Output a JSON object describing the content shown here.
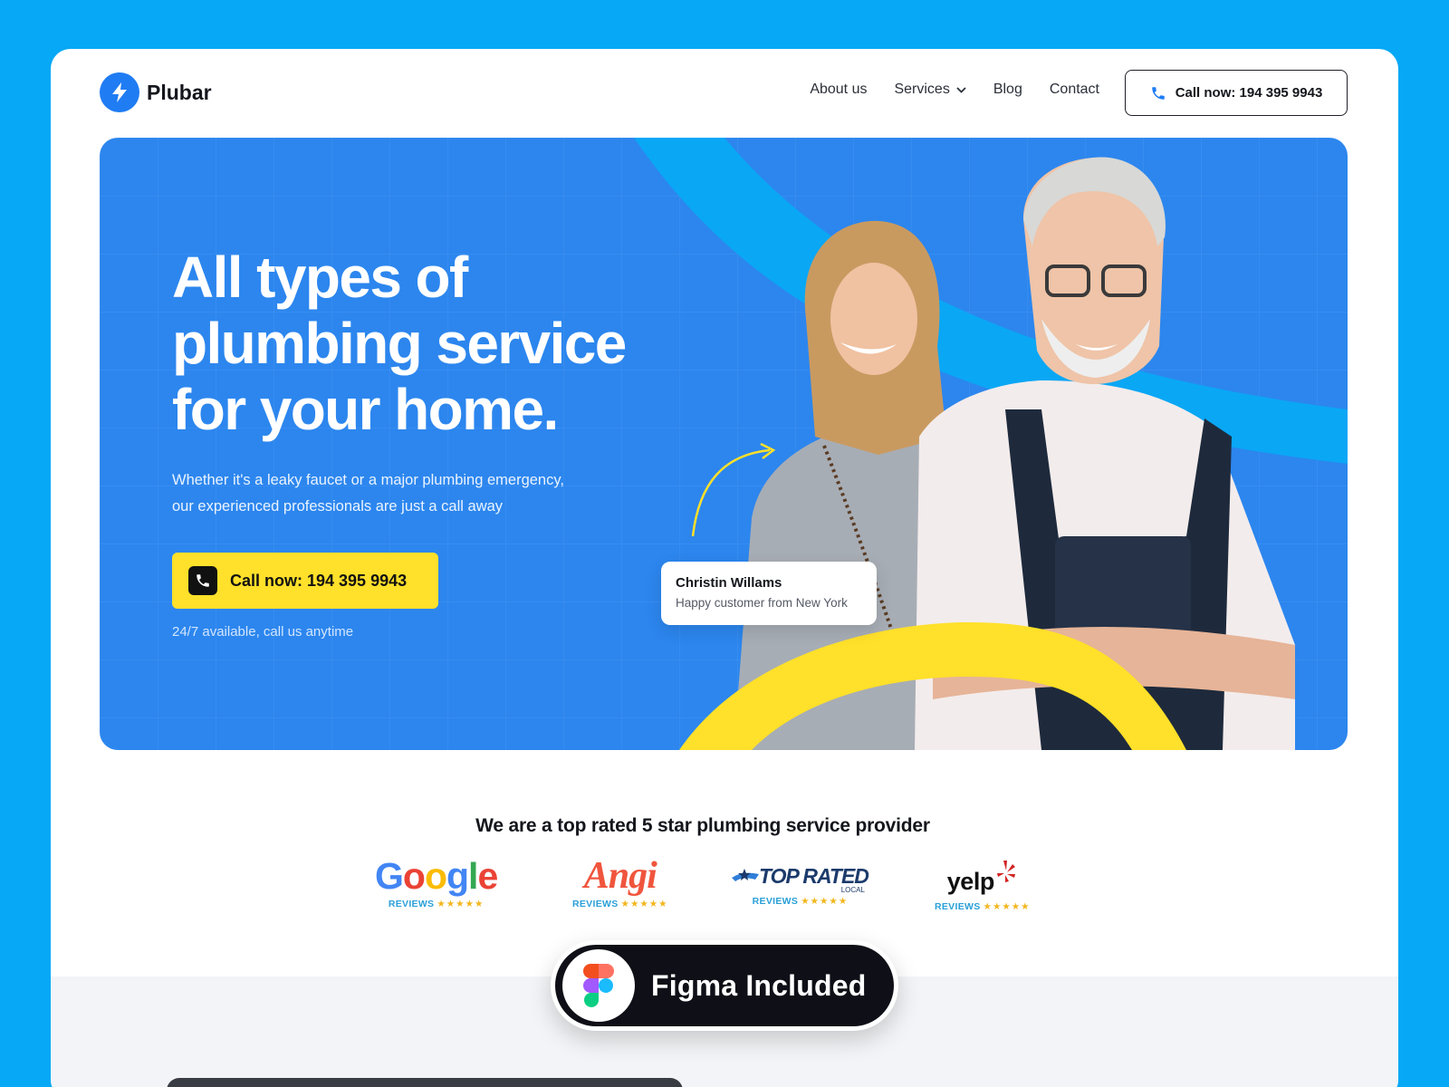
{
  "brand": {
    "name": "Plubar",
    "accent": "#1f7cf3",
    "icon": "lightning-icon"
  },
  "nav": {
    "items": [
      {
        "label": "About us",
        "dropdown": false
      },
      {
        "label": "Services",
        "dropdown": true
      },
      {
        "label": "Blog",
        "dropdown": false
      },
      {
        "label": "Contact",
        "dropdown": false
      }
    ],
    "cta_label": "Call now: 194 395 9943"
  },
  "hero": {
    "title_lines": [
      "All types of",
      "plumbing service",
      "for your home."
    ],
    "subtitle_lines": [
      "Whether it's a leaky faucet or a major plumbing emergency,",
      "our experienced professionals are just a call away"
    ],
    "cta_label": "Call now: 194 395 9943",
    "note": "24/7 available, call us anytime",
    "background": "#2c86ee",
    "cta_color": "#ffe02a",
    "testimonial": {
      "name": "Christin Willams",
      "role": "Happy customer from New York"
    }
  },
  "ratings": {
    "title": "We are a top rated 5 star plumbing service provider",
    "providers": [
      {
        "name": "Google",
        "tag": "REVIEWS",
        "stars": "★★★★★"
      },
      {
        "name": "Angi",
        "tag": "REVIEWS",
        "stars": "★★★★★"
      },
      {
        "name": "TOP RATED",
        "sub": "LOCAL",
        "tag": "REVIEWS",
        "stars": "★★★★★"
      },
      {
        "name": "yelp",
        "tag": "REVIEWS",
        "stars": "★★★★★"
      }
    ]
  },
  "badge": {
    "label": "Figma Included",
    "icon": "figma-icon"
  }
}
